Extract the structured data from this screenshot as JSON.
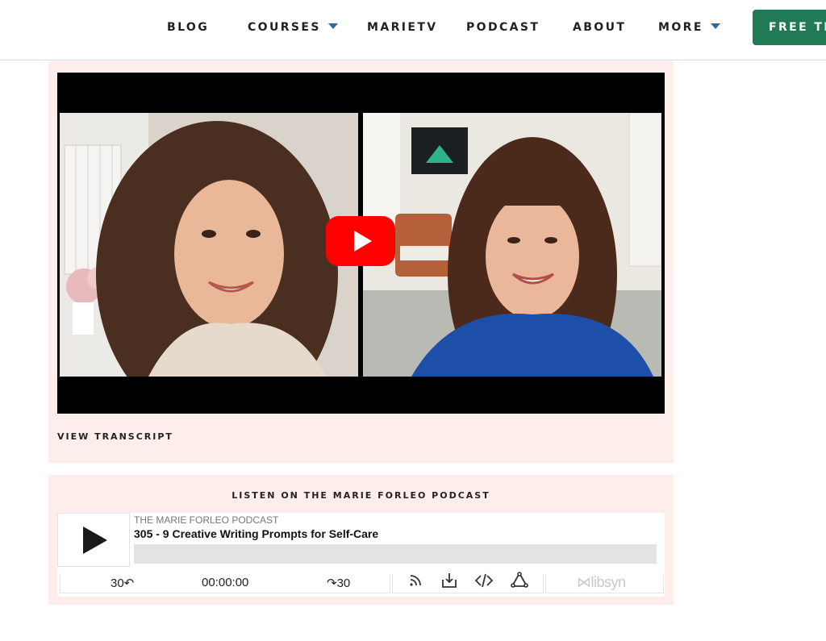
{
  "nav": {
    "items": [
      {
        "label": "BLOG"
      },
      {
        "label": "COURSES"
      },
      {
        "label": "MARIETV"
      },
      {
        "label": "PODCAST"
      },
      {
        "label": "ABOUT"
      },
      {
        "label": "MORE"
      }
    ],
    "cta_label": "FREE TR",
    "cta_color": "#1f7a55",
    "caret_color": "#2c6aa0"
  },
  "video": {
    "play_button_color": "#ff0000",
    "transcript_link": "VIEW TRANSCRIPT"
  },
  "podcast": {
    "heading": "LISTEN ON THE MARIE FORLEO PODCAST",
    "show_name": "THE MARIE FORLEO PODCAST",
    "episode_title": "305 - 9 Creative Writing Prompts for Self-Care",
    "progress": 0,
    "skip_back_label": "30↶",
    "time": "00:00:00",
    "skip_forward_label": "↷30",
    "brand": "libsyn",
    "icons": [
      "rss-icon",
      "download-icon",
      "embed-icon",
      "share-icon"
    ]
  },
  "colors": {
    "card_background": "#fdeeec"
  }
}
